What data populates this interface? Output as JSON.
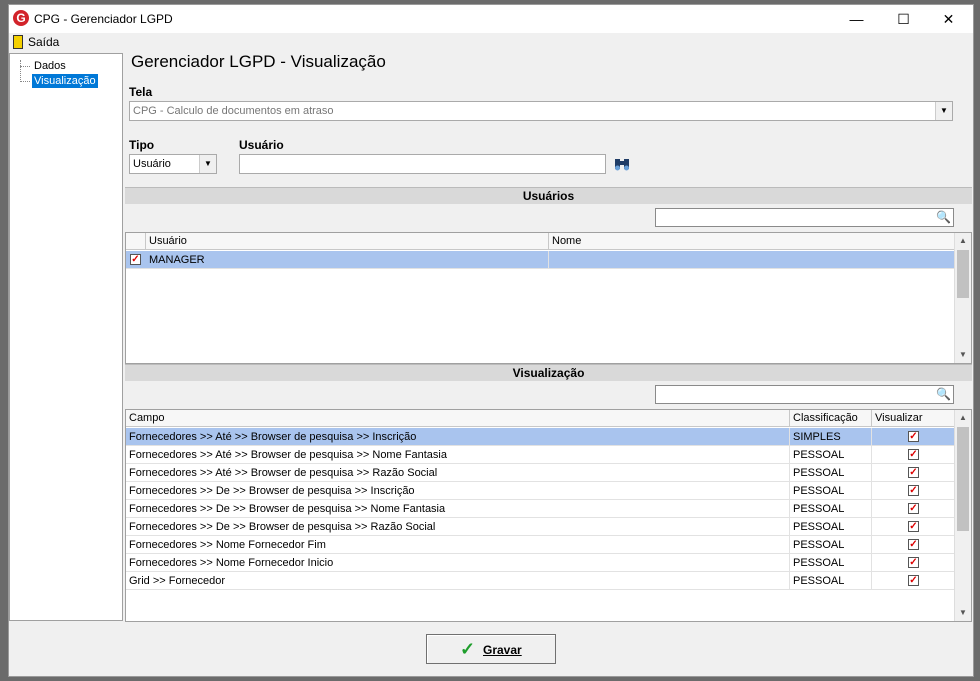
{
  "window": {
    "title": "CPG - Gerenciador LGPD",
    "logo_letter": "G",
    "minimize": "—",
    "maximize": "☐",
    "close": "✕"
  },
  "menu": {
    "exit_label": "Saída"
  },
  "tree": {
    "items": [
      {
        "label": "Dados"
      },
      {
        "label": "Visualização"
      }
    ]
  },
  "page": {
    "title": "Gerenciador LGPD - Visualização",
    "tela_label": "Tela",
    "tela_value": "CPG - Calculo de documentos em atraso",
    "tipo_label": "Tipo",
    "tipo_value": "Usuário",
    "usuario_label": "Usuário",
    "usuario_value": ""
  },
  "usuarios": {
    "section_title": "Usuários",
    "search_value": "",
    "columns": [
      "Usuário",
      "Nome"
    ],
    "rows": [
      {
        "checked": true,
        "usuario": "MANAGER",
        "nome": ""
      }
    ]
  },
  "visualizacao": {
    "section_title": "Visualização",
    "search_value": "",
    "columns": [
      "Campo",
      "Classificação",
      "Visualizar"
    ],
    "rows": [
      {
        "campo": "Fornecedores >> Até >> Browser de pesquisa >> Inscrição",
        "classificacao": "SIMPLES",
        "visualizar": true
      },
      {
        "campo": "Fornecedores >> Até >> Browser de pesquisa >> Nome Fantasia",
        "classificacao": "PESSOAL",
        "visualizar": true
      },
      {
        "campo": "Fornecedores >> Até >> Browser de pesquisa >> Razão Social",
        "classificacao": "PESSOAL",
        "visualizar": true
      },
      {
        "campo": "Fornecedores >> De >> Browser de pesquisa >> Inscrição",
        "classificacao": "PESSOAL",
        "visualizar": true
      },
      {
        "campo": "Fornecedores >> De >> Browser de pesquisa >> Nome Fantasia",
        "classificacao": "PESSOAL",
        "visualizar": true
      },
      {
        "campo": "Fornecedores >> De >> Browser de pesquisa >> Razão Social",
        "classificacao": "PESSOAL",
        "visualizar": true
      },
      {
        "campo": "Fornecedores >> Nome Fornecedor Fim",
        "classificacao": "PESSOAL",
        "visualizar": true
      },
      {
        "campo": "Fornecedores >> Nome Fornecedor Inicio",
        "classificacao": "PESSOAL",
        "visualizar": true
      },
      {
        "campo": "Grid >> Fornecedor",
        "classificacao": "PESSOAL",
        "visualizar": true
      }
    ]
  },
  "footer": {
    "save_label": "Gravar"
  },
  "icons": {
    "check": "✓",
    "search": "search-icon",
    "binoculars": "binoculars-icon"
  }
}
